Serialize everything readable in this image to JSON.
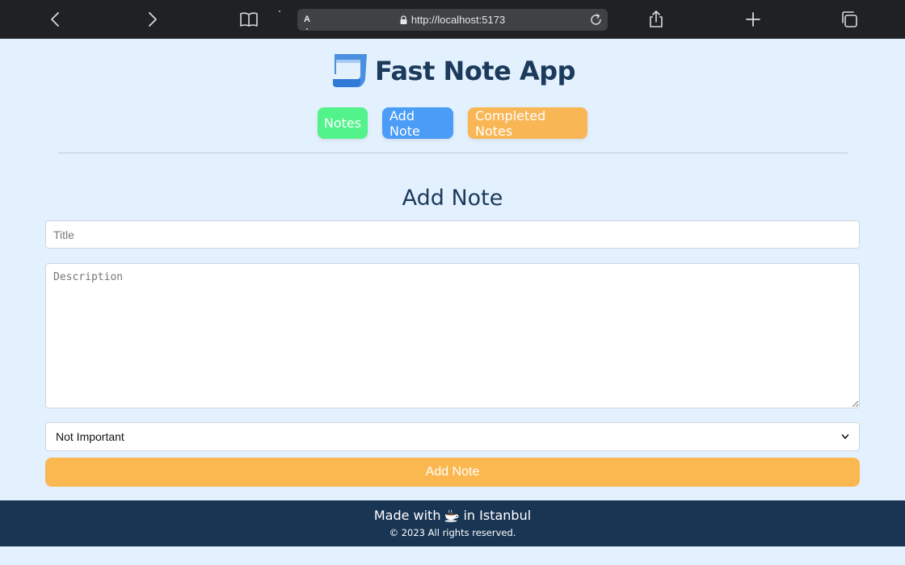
{
  "browser": {
    "reader_label": "A",
    "url": "http://localhost:5173"
  },
  "app": {
    "title": "Fast Note App"
  },
  "nav": {
    "notes_label": "Notes",
    "add_note_label": "Add Note",
    "completed_label": "Completed Notes",
    "colors": {
      "notes": "#52f38a",
      "add_note": "#4a9cf6",
      "completed": "#f9b654"
    }
  },
  "form": {
    "heading": "Add Note",
    "title_placeholder": "Title",
    "title_value": "",
    "description_placeholder": "Description",
    "description_value": "",
    "importance_selected": "Not Important",
    "submit_label": "Add Note"
  },
  "footer": {
    "made_prefix": "Made with",
    "made_suffix": "in Istanbul",
    "copyright": "© 2023 All rights reserved."
  },
  "icons": [
    "back-icon",
    "forward-icon",
    "bookmarks-icon",
    "lock-icon",
    "reload-icon",
    "share-icon",
    "new-tab-icon",
    "tabs-icon",
    "app-logo-icon",
    "coffee-icon",
    "chevron-down-icon"
  ]
}
